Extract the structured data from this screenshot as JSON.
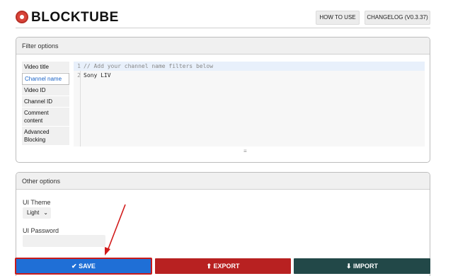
{
  "header": {
    "logo_text": "BLOCKTUBE",
    "how_to_use": "HOW TO USE",
    "changelog": "CHANGELOG (V0.3.37)"
  },
  "filter_options": {
    "title": "Filter options",
    "tabs": [
      "Video title",
      "Channel name",
      "Video ID",
      "Channel ID",
      "Comment content",
      "Advanced Blocking"
    ],
    "active_tab": "Channel name",
    "editor_lines": [
      {
        "num": "1",
        "text": "// Add your channel name filters below"
      },
      {
        "num": "2",
        "text": "Sony LIV"
      }
    ],
    "resize_handle": "≡"
  },
  "other_options": {
    "title": "Other options",
    "ui_theme_label": "UI Theme",
    "ui_theme_value": "Light",
    "ui_password_label": "UI Password"
  },
  "actions": {
    "save": "✔ SAVE",
    "export": "⬆ EXPORT",
    "import": "⬇ IMPORT"
  },
  "colors": {
    "save": "#1f6fd6",
    "export": "#b82121",
    "import": "#224848",
    "annotation": "#d11a1a"
  }
}
